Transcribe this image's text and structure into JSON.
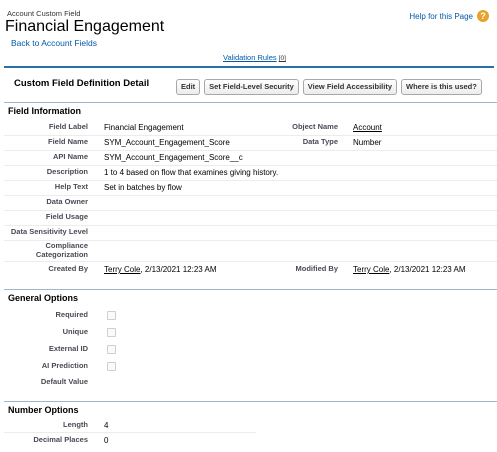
{
  "header": {
    "subtitle": "Account Custom Field",
    "title": "Financial Engagement",
    "back_link": "Back to Account Fields",
    "help_link": "Help for this Page",
    "help_icon": "question-icon"
  },
  "validation": {
    "label": "Validation Rules",
    "count": "[0]"
  },
  "detail": {
    "title": "Custom Field Definition Detail",
    "buttons": {
      "edit": "Edit",
      "fls": "Set Field-Level Security",
      "accessibility": "View Field Accessibility",
      "where_used": "Where is this used?"
    }
  },
  "field_information": {
    "heading": "Field Information",
    "field_label": {
      "label": "Field Label",
      "value": "Financial Engagement"
    },
    "object_name": {
      "label": "Object Name",
      "value": "Account"
    },
    "field_name": {
      "label": "Field Name",
      "value": "SYM_Account_Engagement_Score"
    },
    "data_type": {
      "label": "Data Type",
      "value": "Number"
    },
    "api_name": {
      "label": "API Name",
      "value": "SYM_Account_Engagement_Score__c"
    },
    "description": {
      "label": "Description",
      "value": "1 to 4 based on flow that examines giving history."
    },
    "help_text": {
      "label": "Help Text",
      "value": "Set in batches by flow"
    },
    "data_owner": {
      "label": "Data Owner",
      "value": ""
    },
    "field_usage": {
      "label": "Field Usage",
      "value": ""
    },
    "data_sensitivity": {
      "label": "Data Sensitivity Level",
      "value": ""
    },
    "compliance": {
      "label": "Compliance Categorization",
      "value": ""
    },
    "created_by": {
      "label": "Created By",
      "user": "Terry Cole",
      "date": ", 2/13/2021 12:23 AM"
    },
    "modified_by": {
      "label": "Modified By",
      "user": "Terry Cole",
      "date": ", 2/13/2021 12:23 AM"
    }
  },
  "general_options": {
    "heading": "General Options",
    "required": {
      "label": "Required",
      "checked": false
    },
    "unique": {
      "label": "Unique",
      "checked": false
    },
    "external_id": {
      "label": "External ID",
      "checked": false
    },
    "ai_prediction": {
      "label": "AI Prediction",
      "checked": false
    },
    "default_value": {
      "label": "Default Value",
      "value": ""
    }
  },
  "number_options": {
    "heading": "Number Options",
    "length": {
      "label": "Length",
      "value": "4"
    },
    "decimal_places": {
      "label": "Decimal Places",
      "value": "0"
    }
  },
  "colors": {
    "link": "#015ba7",
    "section_rule": "#2a6fa8",
    "help_icon": "#e8a22c"
  }
}
